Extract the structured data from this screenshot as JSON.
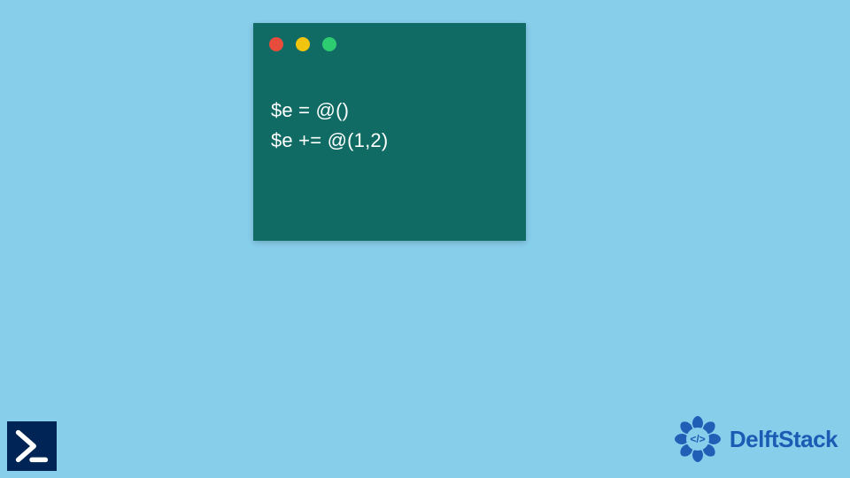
{
  "code": {
    "line1": "$e = @()",
    "line2": "$e += @(1,2)"
  },
  "logo": {
    "brand_text": "DelftStack"
  },
  "colors": {
    "background": "#87ceeb",
    "window": "#0f6b63",
    "ps_icon": "#012456",
    "brand": "#1a5bb4",
    "dot_red": "#e74c3c",
    "dot_yellow": "#f1c40f",
    "dot_green": "#2ecc71"
  }
}
